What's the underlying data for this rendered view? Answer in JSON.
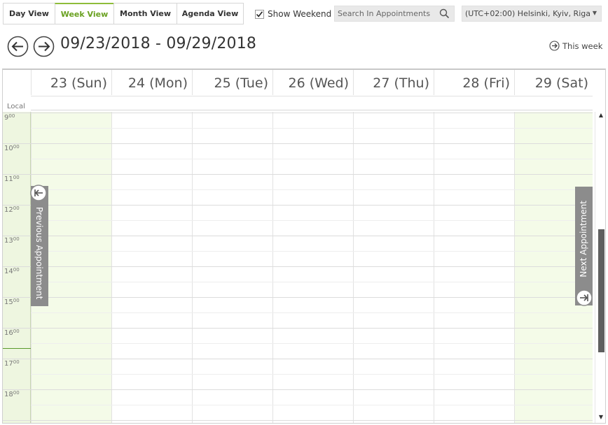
{
  "views": [
    {
      "label": "Day View",
      "active": false
    },
    {
      "label": "Week View",
      "active": true
    },
    {
      "label": "Month View",
      "active": false
    },
    {
      "label": "Agenda View",
      "active": false
    }
  ],
  "show_weekend": {
    "label": "Show Weekend",
    "checked": true
  },
  "search": {
    "placeholder": "Search In Appointments"
  },
  "timezone": {
    "selected": "(UTC+02:00) Helsinki, Kyiv, Riga,"
  },
  "nav": {
    "date_range": "09/23/2018 - 09/29/2018",
    "this_week": "This week"
  },
  "days": [
    {
      "label": "23 (Sun)",
      "weekend": true
    },
    {
      "label": "24 (Mon)",
      "weekend": false
    },
    {
      "label": "25 (Tue)",
      "weekend": false
    },
    {
      "label": "26 (Wed)",
      "weekend": false
    },
    {
      "label": "27 (Thu)",
      "weekend": false
    },
    {
      "label": "28 (Fri)",
      "weekend": false
    },
    {
      "label": "29 (Sat)",
      "weekend": true
    }
  ],
  "timezone_column_label": "Local",
  "hours": [
    "9",
    "10",
    "11",
    "12",
    "13",
    "14",
    "15",
    "16",
    "17",
    "18"
  ],
  "hour_suffix": "00",
  "prev_appointment": "Previous Appointment",
  "next_appointment": "Next Appointment",
  "colors": {
    "accent": "#6aa121",
    "weekend_bg": "#f4fbe8",
    "gutter_bg": "#eef6e0",
    "side_tab": "#8c8c8c"
  },
  "icons": {
    "search": "search-icon",
    "prev": "arrow-left-circle-icon",
    "next": "arrow-right-circle-icon",
    "this_week": "arrow-right-small-circle-icon",
    "check": "checkmark-icon"
  }
}
